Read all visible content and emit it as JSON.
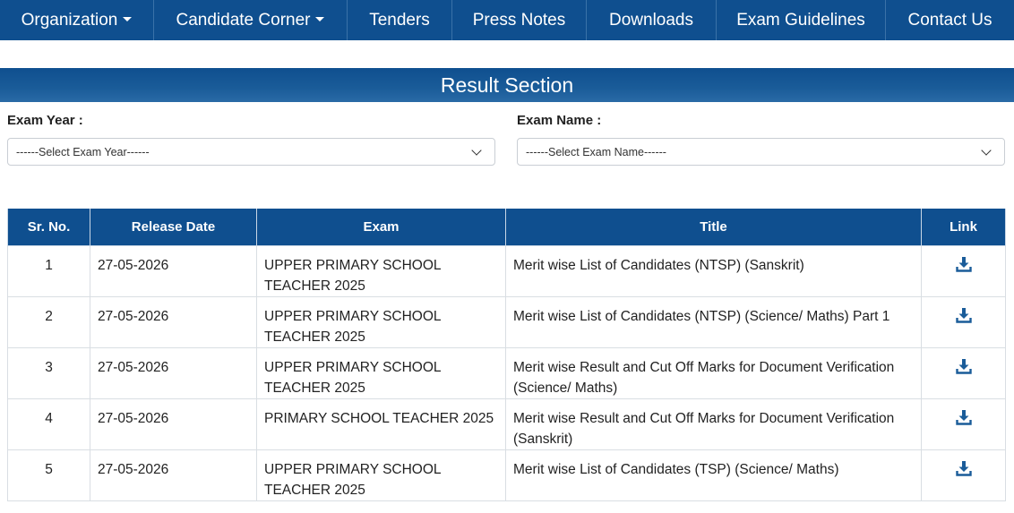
{
  "nav": {
    "items": [
      {
        "label": "Organization",
        "dropdown": true
      },
      {
        "label": "Candidate Corner",
        "dropdown": true
      },
      {
        "label": "Tenders",
        "dropdown": false
      },
      {
        "label": "Press Notes",
        "dropdown": false
      },
      {
        "label": "Downloads",
        "dropdown": false
      },
      {
        "label": "Exam Guidelines",
        "dropdown": false
      },
      {
        "label": "Contact Us",
        "dropdown": false
      }
    ]
  },
  "section": {
    "title": "Result Section"
  },
  "filters": {
    "year_label": "Exam Year :",
    "year_value": "------Select Exam Year------",
    "name_label": "Exam Name :",
    "name_value": "------Select Exam Name------"
  },
  "table": {
    "headers": [
      "Sr. No.",
      "Release Date",
      "Exam",
      "Title",
      "Link"
    ],
    "rows": [
      {
        "sr": "1",
        "date": "27-05-2026",
        "exam": "UPPER PRIMARY SCHOOL TEACHER 2025",
        "title": "Merit wise List of Candidates (NTSP) (Sanskrit)"
      },
      {
        "sr": "2",
        "date": "27-05-2026",
        "exam": "UPPER PRIMARY SCHOOL TEACHER 2025",
        "title": "Merit wise List of Candidates (NTSP) (Science/ Maths) Part 1"
      },
      {
        "sr": "3",
        "date": "27-05-2026",
        "exam": "UPPER PRIMARY SCHOOL TEACHER 2025",
        "title": "Merit wise Result and Cut Off Marks for Document Verification (Science/ Maths)"
      },
      {
        "sr": "4",
        "date": "27-05-2026",
        "exam": "PRIMARY SCHOOL TEACHER 2025",
        "title": "Merit wise Result and Cut Off Marks for Document Verification (Sanskrit)"
      },
      {
        "sr": "5",
        "date": "27-05-2026",
        "exam": "UPPER PRIMARY SCHOOL TEACHER 2025",
        "title": "Merit wise List of Candidates (TSP) (Science/ Maths)"
      }
    ],
    "link_icon": "download-icon"
  },
  "colors": {
    "primary": "#0f4f8f",
    "icon": "#1a5c99"
  }
}
